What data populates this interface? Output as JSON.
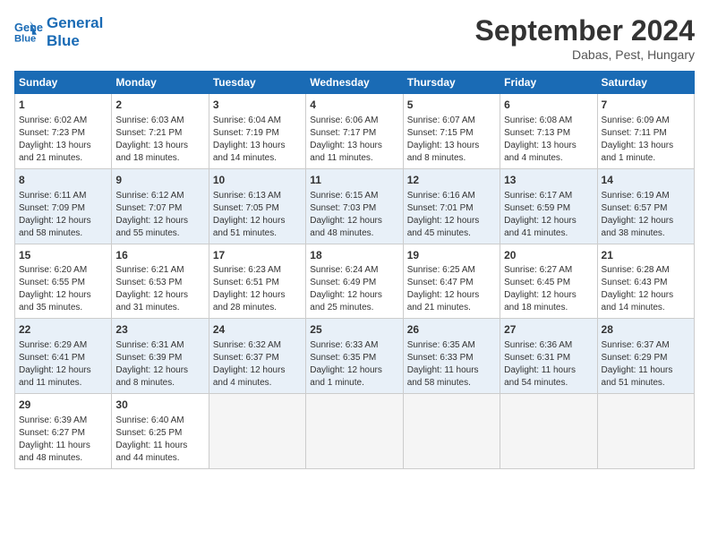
{
  "header": {
    "logo_line1": "General",
    "logo_line2": "Blue",
    "month_title": "September 2024",
    "location": "Dabas, Pest, Hungary"
  },
  "weekdays": [
    "Sunday",
    "Monday",
    "Tuesday",
    "Wednesday",
    "Thursday",
    "Friday",
    "Saturday"
  ],
  "weeks": [
    [
      {
        "day": "1",
        "lines": [
          "Sunrise: 6:02 AM",
          "Sunset: 7:23 PM",
          "Daylight: 13 hours",
          "and 21 minutes."
        ]
      },
      {
        "day": "2",
        "lines": [
          "Sunrise: 6:03 AM",
          "Sunset: 7:21 PM",
          "Daylight: 13 hours",
          "and 18 minutes."
        ]
      },
      {
        "day": "3",
        "lines": [
          "Sunrise: 6:04 AM",
          "Sunset: 7:19 PM",
          "Daylight: 13 hours",
          "and 14 minutes."
        ]
      },
      {
        "day": "4",
        "lines": [
          "Sunrise: 6:06 AM",
          "Sunset: 7:17 PM",
          "Daylight: 13 hours",
          "and 11 minutes."
        ]
      },
      {
        "day": "5",
        "lines": [
          "Sunrise: 6:07 AM",
          "Sunset: 7:15 PM",
          "Daylight: 13 hours",
          "and 8 minutes."
        ]
      },
      {
        "day": "6",
        "lines": [
          "Sunrise: 6:08 AM",
          "Sunset: 7:13 PM",
          "Daylight: 13 hours",
          "and 4 minutes."
        ]
      },
      {
        "day": "7",
        "lines": [
          "Sunrise: 6:09 AM",
          "Sunset: 7:11 PM",
          "Daylight: 13 hours",
          "and 1 minute."
        ]
      }
    ],
    [
      {
        "day": "8",
        "lines": [
          "Sunrise: 6:11 AM",
          "Sunset: 7:09 PM",
          "Daylight: 12 hours",
          "and 58 minutes."
        ]
      },
      {
        "day": "9",
        "lines": [
          "Sunrise: 6:12 AM",
          "Sunset: 7:07 PM",
          "Daylight: 12 hours",
          "and 55 minutes."
        ]
      },
      {
        "day": "10",
        "lines": [
          "Sunrise: 6:13 AM",
          "Sunset: 7:05 PM",
          "Daylight: 12 hours",
          "and 51 minutes."
        ]
      },
      {
        "day": "11",
        "lines": [
          "Sunrise: 6:15 AM",
          "Sunset: 7:03 PM",
          "Daylight: 12 hours",
          "and 48 minutes."
        ]
      },
      {
        "day": "12",
        "lines": [
          "Sunrise: 6:16 AM",
          "Sunset: 7:01 PM",
          "Daylight: 12 hours",
          "and 45 minutes."
        ]
      },
      {
        "day": "13",
        "lines": [
          "Sunrise: 6:17 AM",
          "Sunset: 6:59 PM",
          "Daylight: 12 hours",
          "and 41 minutes."
        ]
      },
      {
        "day": "14",
        "lines": [
          "Sunrise: 6:19 AM",
          "Sunset: 6:57 PM",
          "Daylight: 12 hours",
          "and 38 minutes."
        ]
      }
    ],
    [
      {
        "day": "15",
        "lines": [
          "Sunrise: 6:20 AM",
          "Sunset: 6:55 PM",
          "Daylight: 12 hours",
          "and 35 minutes."
        ]
      },
      {
        "day": "16",
        "lines": [
          "Sunrise: 6:21 AM",
          "Sunset: 6:53 PM",
          "Daylight: 12 hours",
          "and 31 minutes."
        ]
      },
      {
        "day": "17",
        "lines": [
          "Sunrise: 6:23 AM",
          "Sunset: 6:51 PM",
          "Daylight: 12 hours",
          "and 28 minutes."
        ]
      },
      {
        "day": "18",
        "lines": [
          "Sunrise: 6:24 AM",
          "Sunset: 6:49 PM",
          "Daylight: 12 hours",
          "and 25 minutes."
        ]
      },
      {
        "day": "19",
        "lines": [
          "Sunrise: 6:25 AM",
          "Sunset: 6:47 PM",
          "Daylight: 12 hours",
          "and 21 minutes."
        ]
      },
      {
        "day": "20",
        "lines": [
          "Sunrise: 6:27 AM",
          "Sunset: 6:45 PM",
          "Daylight: 12 hours",
          "and 18 minutes."
        ]
      },
      {
        "day": "21",
        "lines": [
          "Sunrise: 6:28 AM",
          "Sunset: 6:43 PM",
          "Daylight: 12 hours",
          "and 14 minutes."
        ]
      }
    ],
    [
      {
        "day": "22",
        "lines": [
          "Sunrise: 6:29 AM",
          "Sunset: 6:41 PM",
          "Daylight: 12 hours",
          "and 11 minutes."
        ]
      },
      {
        "day": "23",
        "lines": [
          "Sunrise: 6:31 AM",
          "Sunset: 6:39 PM",
          "Daylight: 12 hours",
          "and 8 minutes."
        ]
      },
      {
        "day": "24",
        "lines": [
          "Sunrise: 6:32 AM",
          "Sunset: 6:37 PM",
          "Daylight: 12 hours",
          "and 4 minutes."
        ]
      },
      {
        "day": "25",
        "lines": [
          "Sunrise: 6:33 AM",
          "Sunset: 6:35 PM",
          "Daylight: 12 hours",
          "and 1 minute."
        ]
      },
      {
        "day": "26",
        "lines": [
          "Sunrise: 6:35 AM",
          "Sunset: 6:33 PM",
          "Daylight: 11 hours",
          "and 58 minutes."
        ]
      },
      {
        "day": "27",
        "lines": [
          "Sunrise: 6:36 AM",
          "Sunset: 6:31 PM",
          "Daylight: 11 hours",
          "and 54 minutes."
        ]
      },
      {
        "day": "28",
        "lines": [
          "Sunrise: 6:37 AM",
          "Sunset: 6:29 PM",
          "Daylight: 11 hours",
          "and 51 minutes."
        ]
      }
    ],
    [
      {
        "day": "29",
        "lines": [
          "Sunrise: 6:39 AM",
          "Sunset: 6:27 PM",
          "Daylight: 11 hours",
          "and 48 minutes."
        ]
      },
      {
        "day": "30",
        "lines": [
          "Sunrise: 6:40 AM",
          "Sunset: 6:25 PM",
          "Daylight: 11 hours",
          "and 44 minutes."
        ]
      },
      {
        "day": "",
        "lines": []
      },
      {
        "day": "",
        "lines": []
      },
      {
        "day": "",
        "lines": []
      },
      {
        "day": "",
        "lines": []
      },
      {
        "day": "",
        "lines": []
      }
    ]
  ]
}
